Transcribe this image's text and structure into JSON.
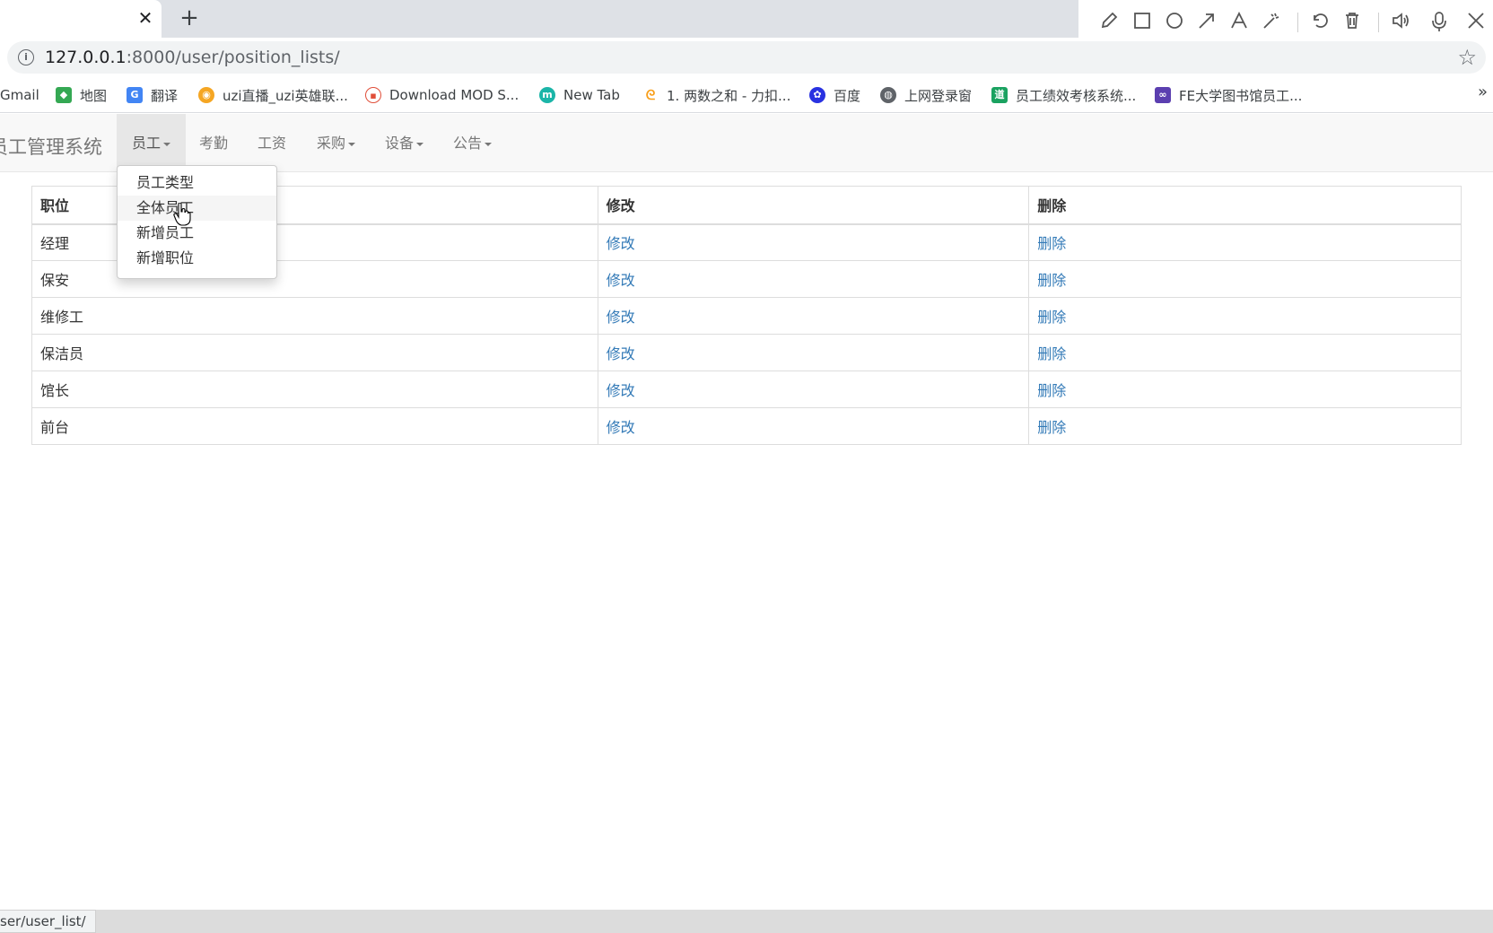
{
  "browser": {
    "tab_close": "✕",
    "new_tab": "+",
    "url_host": "127.0.0.1",
    "url_rest": ":8000/user/position_lists/",
    "status_url": "ser/user_list/",
    "bookmarks": [
      {
        "label": "Gmail",
        "icon": "gmail-icon"
      },
      {
        "label": "地图",
        "icon": "maps-icon"
      },
      {
        "label": "翻译",
        "icon": "translate-icon"
      },
      {
        "label": "uzi直播_uzi英雄联...",
        "icon": "stream-icon"
      },
      {
        "label": "Download MOD S...",
        "icon": "tv-icon"
      },
      {
        "label": "New Tab",
        "icon": "m-icon"
      },
      {
        "label": "1. 两数之和 - 力扣...",
        "icon": "leetcode-icon"
      },
      {
        "label": "百度",
        "icon": "baidu-icon"
      },
      {
        "label": "上网登录窗",
        "icon": "globe-icon"
      },
      {
        "label": "员工绩效考核系统...",
        "icon": "doc-icon"
      },
      {
        "label": "FE大学图书馆员工...",
        "icon": "infinity-icon"
      }
    ],
    "colors": {
      "tab_bg": "#dee1e6",
      "omnibox_bg": "#f1f3f4",
      "link": "#337ab7"
    }
  },
  "navbar": {
    "brand": "员工管理系统",
    "items": [
      {
        "label": "员工",
        "dropdown": true,
        "active": true
      },
      {
        "label": "考勤",
        "dropdown": false
      },
      {
        "label": "工资",
        "dropdown": false
      },
      {
        "label": "采购",
        "dropdown": true
      },
      {
        "label": "设备",
        "dropdown": true
      },
      {
        "label": "公告",
        "dropdown": true
      }
    ]
  },
  "dropdown": {
    "items": [
      "员工类型",
      "全体员工",
      "新增员工",
      "新增职位"
    ],
    "hovered_index": 1
  },
  "table": {
    "headers": [
      "职位",
      "修改",
      "删除"
    ],
    "rows": [
      {
        "position": "经理",
        "edit": "修改",
        "delete": "删除"
      },
      {
        "position": "保安",
        "edit": "修改",
        "delete": "删除"
      },
      {
        "position": "维修工",
        "edit": "修改",
        "delete": "删除"
      },
      {
        "position": "保洁员",
        "edit": "修改",
        "delete": "删除"
      },
      {
        "position": "馆长",
        "edit": "修改",
        "delete": "删除"
      },
      {
        "position": "前台",
        "edit": "修改",
        "delete": "删除"
      }
    ]
  }
}
